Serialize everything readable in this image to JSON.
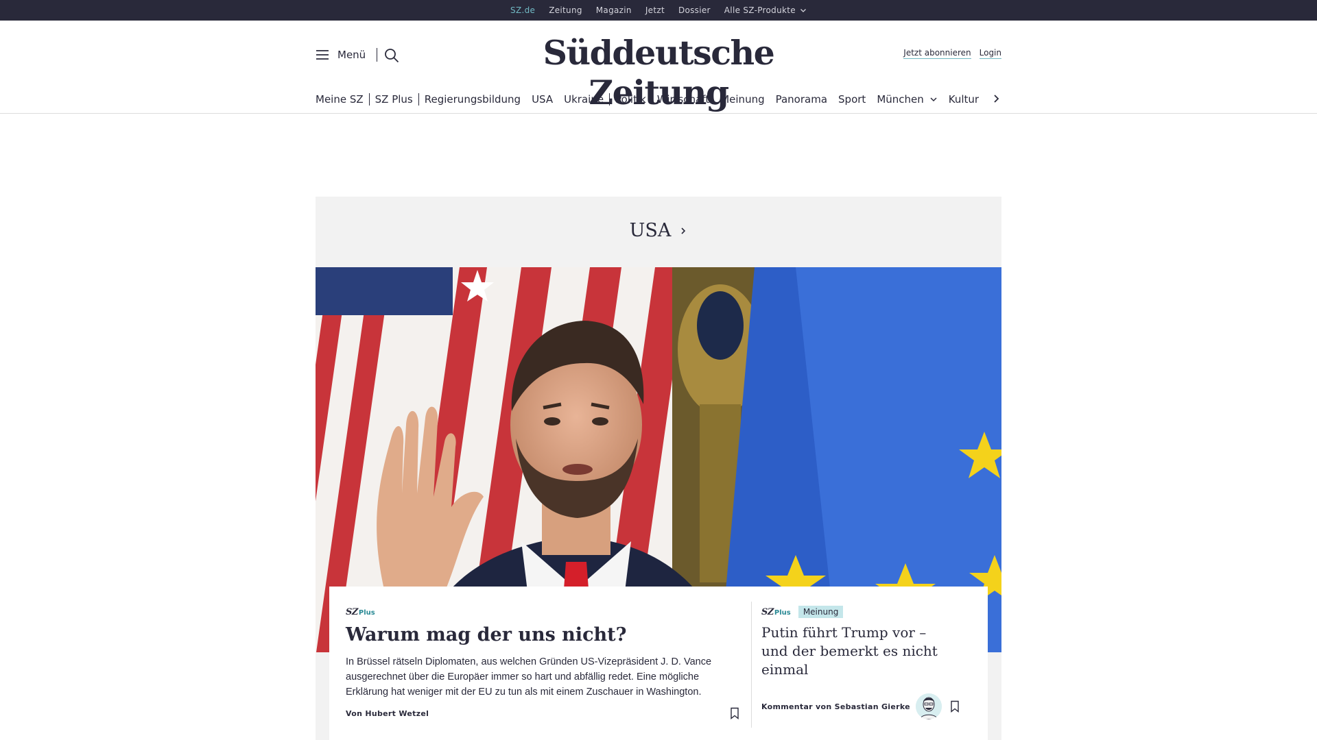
{
  "topbar": {
    "links": [
      {
        "label": "SZ.de"
      },
      {
        "label": "Zeitung"
      },
      {
        "label": "Magazin"
      },
      {
        "label": "Jetzt"
      },
      {
        "label": "Dossier"
      },
      {
        "label": "Alle SZ-Produkte"
      }
    ]
  },
  "header": {
    "menu_label": "Menü",
    "logo": "Süddeutsche Zeitung",
    "subscribe": "Jetzt abonnieren",
    "login": "Login"
  },
  "nav": {
    "items": [
      "Meine SZ",
      "SZ Plus",
      "Regierungsbildung",
      "USA",
      "Ukraine",
      "Politik",
      "Wirtschaft",
      "Meinung",
      "Panorama",
      "Sport",
      "München",
      "Kultur"
    ]
  },
  "section": {
    "title": "USA"
  },
  "main_article": {
    "badge_sz": "SZ",
    "badge_plus": "Plus",
    "headline": "Warum mag der uns nicht?",
    "teaser_lines": [
      "In Brüssel rätseln Diplomaten, aus welchen Gründen US-Vizepräsident J. D. Vance",
      "ausgerechnet über die Europäer immer so hart und abfällig redet. Eine mögliche",
      "Erklärung hat weniger mit der EU zu tun als mit einem Zuschauer in Washington."
    ],
    "byline": "Von Hubert Wetzel"
  },
  "side_article": {
    "badge_sz": "SZ",
    "badge_plus": "Plus",
    "tag": "Meinung",
    "headline_lines": [
      "Putin führt Trump vor –",
      "und der bemerkt es nicht",
      "einmal"
    ],
    "byline": "Kommentar von Sebastian Gierke"
  },
  "colors": {
    "dark": "#29293a",
    "accent": "#71b9c4",
    "tag_bg": "#c4e6ea"
  }
}
